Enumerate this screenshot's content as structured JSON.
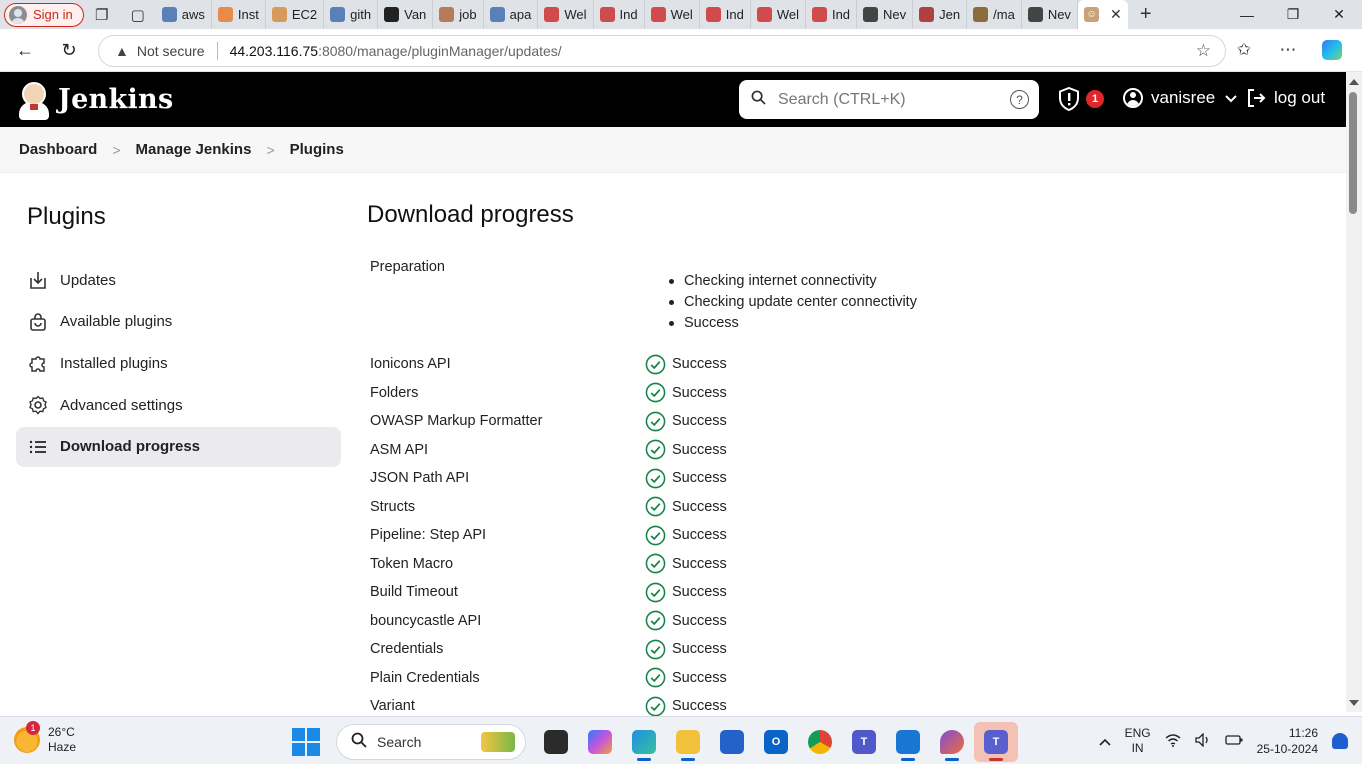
{
  "browser": {
    "signin_label": "Sign in",
    "tabs": [
      {
        "label": "aws",
        "fav": "search-icon",
        "color": "#5b7fb8"
      },
      {
        "label": "Inst",
        "fav": "page-icon",
        "color": "#e88a4a"
      },
      {
        "label": "EC2",
        "fav": "box-icon",
        "color": "#d89a5b"
      },
      {
        "label": "gith",
        "fav": "search-icon",
        "color": "#5b7fb8"
      },
      {
        "label": "Van",
        "fav": "github-icon",
        "color": "#222222"
      },
      {
        "label": "job",
        "fav": "jenkins-icon",
        "color": "#b77b5b"
      },
      {
        "label": "apa",
        "fav": "search-icon",
        "color": "#5b7fb8"
      },
      {
        "label": "Wel",
        "fav": "slash-icon",
        "color": "#d04b4b"
      },
      {
        "label": "Ind",
        "fav": "slash-icon",
        "color": "#d04b4b"
      },
      {
        "label": "Wel",
        "fav": "slash-icon",
        "color": "#d04b4b"
      },
      {
        "label": "Ind",
        "fav": "slash-icon",
        "color": "#d04b4b"
      },
      {
        "label": "Wel",
        "fav": "slash-icon",
        "color": "#d04b4b"
      },
      {
        "label": "Ind",
        "fav": "slash-icon",
        "color": "#d04b4b"
      },
      {
        "label": "Nev",
        "fav": "newtab-icon",
        "color": "#444444"
      },
      {
        "label": "Jen",
        "fav": "jenkins-icon",
        "color": "#b04040"
      },
      {
        "label": "/ma",
        "fav": "image-icon",
        "color": "#8a6d3b"
      },
      {
        "label": "Nev",
        "fav": "newtab-icon",
        "color": "#444444"
      }
    ],
    "not_secure_label": "Not secure",
    "url_host": "44.203.116.75",
    "url_path": ":8080/manage/pluginManager/updates/"
  },
  "jenkins": {
    "brand": "Jenkins",
    "search_placeholder": "Search (CTRL+K)",
    "help_glyph": "?",
    "security_count": "1",
    "username": "vanisree",
    "logout_label": "log out"
  },
  "breadcrumb": [
    "Dashboard",
    "Manage Jenkins",
    "Plugins"
  ],
  "sidebar": {
    "title": "Plugins",
    "items": [
      {
        "label": "Updates",
        "icon": "download-icon"
      },
      {
        "label": "Available plugins",
        "icon": "shopping-bag-icon"
      },
      {
        "label": "Installed plugins",
        "icon": "puzzle-icon"
      },
      {
        "label": "Advanced settings",
        "icon": "gear-icon"
      },
      {
        "label": "Download progress",
        "icon": "list-icon",
        "active": true
      }
    ]
  },
  "main": {
    "title": "Download progress",
    "preparation": {
      "label": "Preparation",
      "steps": [
        "Checking internet connectivity",
        "Checking update center connectivity",
        "Success"
      ]
    },
    "plugins": [
      {
        "name": "Ionicons API",
        "status": "Success"
      },
      {
        "name": "Folders",
        "status": "Success"
      },
      {
        "name": "OWASP Markup Formatter",
        "status": "Success"
      },
      {
        "name": "ASM API",
        "status": "Success"
      },
      {
        "name": "JSON Path API",
        "status": "Success"
      },
      {
        "name": "Structs",
        "status": "Success"
      },
      {
        "name": "Pipeline: Step API",
        "status": "Success"
      },
      {
        "name": "Token Macro",
        "status": "Success"
      },
      {
        "name": "Build Timeout",
        "status": "Success"
      },
      {
        "name": "bouncycastle API",
        "status": "Success"
      },
      {
        "name": "Credentials",
        "status": "Success"
      },
      {
        "name": "Plain Credentials",
        "status": "Success"
      },
      {
        "name": "Variant",
        "status": "Success"
      }
    ],
    "success_color": "#138347"
  },
  "taskbar": {
    "weather_badge": "1",
    "temperature": "26°C",
    "condition": "Haze",
    "search_label": "Search",
    "lang_line1": "ENG",
    "lang_line2": "IN",
    "time": "11:26",
    "date": "25-10-2024"
  }
}
